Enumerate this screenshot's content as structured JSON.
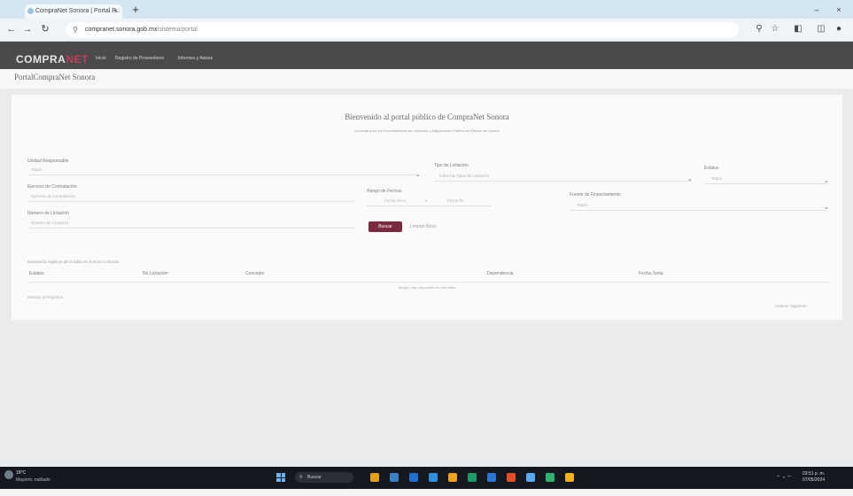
{
  "browser": {
    "tab_title": "CompraNet Sonora | Portal P...",
    "tab_close": "×",
    "new_tab": "+",
    "url_host": "compranet.sonora.gob.mx",
    "url_path": "/sistema/portal",
    "win_min": "–",
    "win_close": "×",
    "back": "←",
    "forward": "→",
    "reload": "↻"
  },
  "site": {
    "logo_main": "COMPRA",
    "logo_accent": "NET",
    "nav": [
      "Inicio",
      "Registro de Proveedores",
      "Informes y Avisos"
    ]
  },
  "portal": {
    "title": "PortalCompraNet Sonora"
  },
  "card": {
    "welcome": "Bienvenido al portal público de CompraNet Sonora",
    "subtitle": "Consulta aquí los Procedimientos de Licitación y Adjudicación Pública del Estado de Sonora",
    "filters": {
      "unidad_label": "Unidad Responsable",
      "unidad_value": "Todas",
      "ejercicio_label": "Ejercicio de Contratación",
      "ejercicio_value": "Ejercicio de Contratación",
      "numero_label": "Número de Licitación",
      "numero_value": "Número de Licitación",
      "tipo_label": "Tipo de Licitación",
      "tipo_value": "Todos los Tipos de Licitación",
      "rango_label": "Rango de Fechas",
      "rango_from": "Fecha inicio",
      "rango_sep": "a",
      "rango_to": "Fecha fin",
      "estatus_label": "Estatus",
      "estatus_value": "Todos",
      "fuente_label": "Fuente de Financiamiento",
      "fuente_value": "Todas"
    },
    "search_button": "Buscar",
    "clear_link": "Limpiar filtros",
    "results_heading": "Mostrando registros de la tabla en Sonora Compras",
    "columns": [
      "Estatus",
      "No Licitación",
      "Concepto",
      "Dependencia",
      "Fecha Junta"
    ],
    "no_data": "Ningún dato disponible en esta tabla",
    "show_entries": "Mostrar  10  registros",
    "pager": "Anterior   Siguiente"
  },
  "taskbar": {
    "weather_temp": "18°C",
    "weather_desc": "Mayorm. nublado",
    "search_placeholder": "Buscar",
    "time": "03:51 p. m.",
    "date": "07/05/2024",
    "app_colors": [
      "#e3a21a",
      "#3b82c4",
      "#1f6fd1",
      "#2d8fe0",
      "#f0a31c",
      "#1c9c6a",
      "#2b76d6",
      "#e44d26",
      "#5aa9f0",
      "#2db36f",
      "#f2b11b"
    ]
  }
}
